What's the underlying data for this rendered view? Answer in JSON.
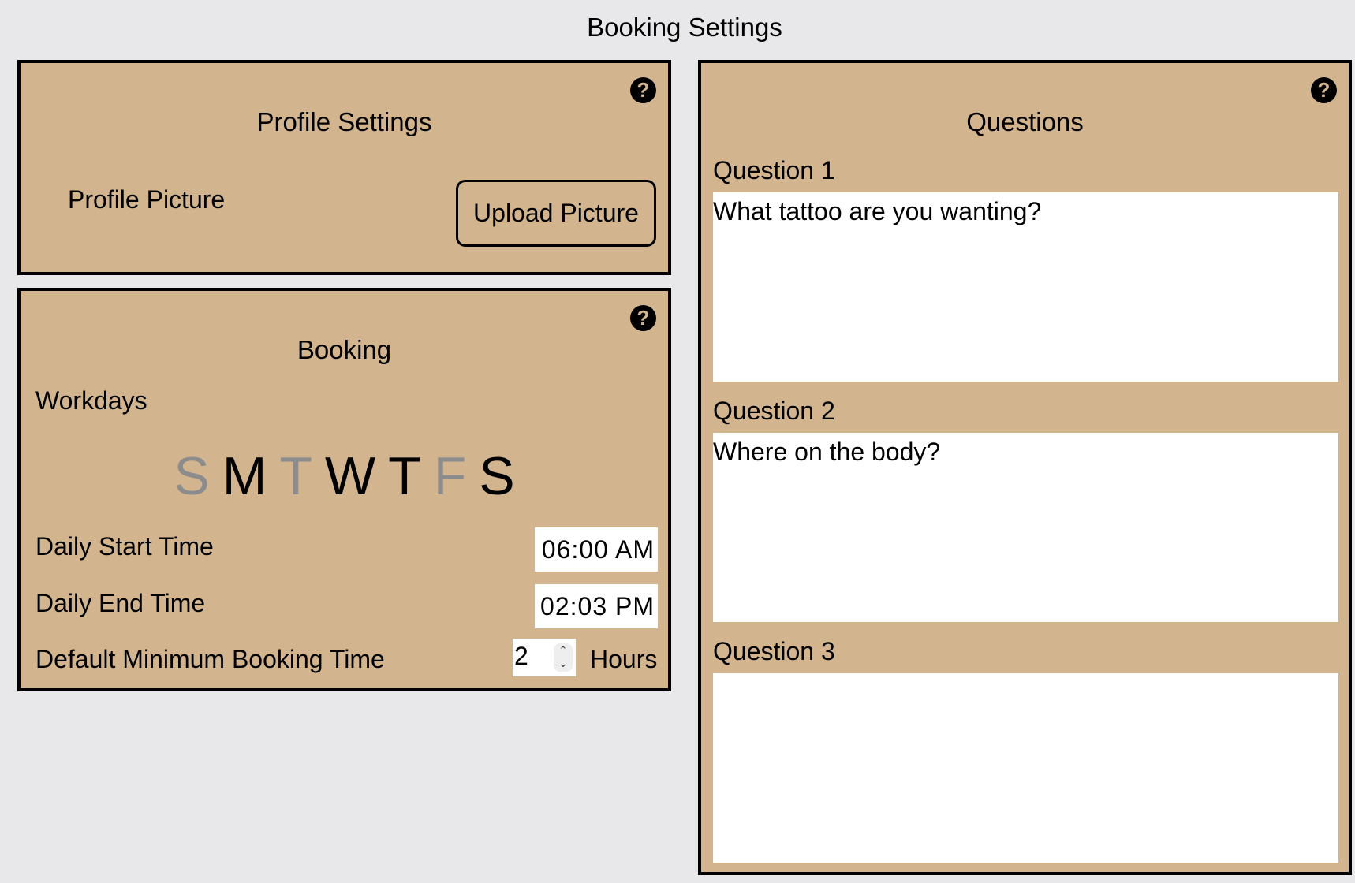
{
  "page": {
    "title": "Booking Settings"
  },
  "colors": {
    "background": "#e8e8ea",
    "panel": "#d2b48f",
    "border": "#000000",
    "day_off": "#8c8c8c"
  },
  "profile": {
    "title": "Profile Settings",
    "picture_label": "Profile Picture",
    "upload_button": "Upload Picture",
    "help_icon": "question-circle-icon"
  },
  "booking": {
    "title": "Booking",
    "workdays_label": "Workdays",
    "days": [
      {
        "letter": "S",
        "enabled": false
      },
      {
        "letter": "M",
        "enabled": true
      },
      {
        "letter": "T",
        "enabled": false
      },
      {
        "letter": "W",
        "enabled": true
      },
      {
        "letter": "T",
        "enabled": true
      },
      {
        "letter": "F",
        "enabled": false
      },
      {
        "letter": "S",
        "enabled": true
      }
    ],
    "start_label": "Daily Start Time",
    "start_time": "06:00 AM",
    "end_label": "Daily End Time",
    "end_time": "02:03 PM",
    "min_label": "Default Minimum Booking Time",
    "min_value": "2",
    "min_unit": "Hours",
    "help_icon": "question-circle-icon"
  },
  "questions": {
    "title": "Questions",
    "help_icon": "question-circle-icon",
    "items": [
      {
        "label": "Question 1",
        "value": "What tattoo are you wanting?"
      },
      {
        "label": "Question 2",
        "value": "Where on the body?"
      },
      {
        "label": "Question 3",
        "value": ""
      }
    ]
  }
}
